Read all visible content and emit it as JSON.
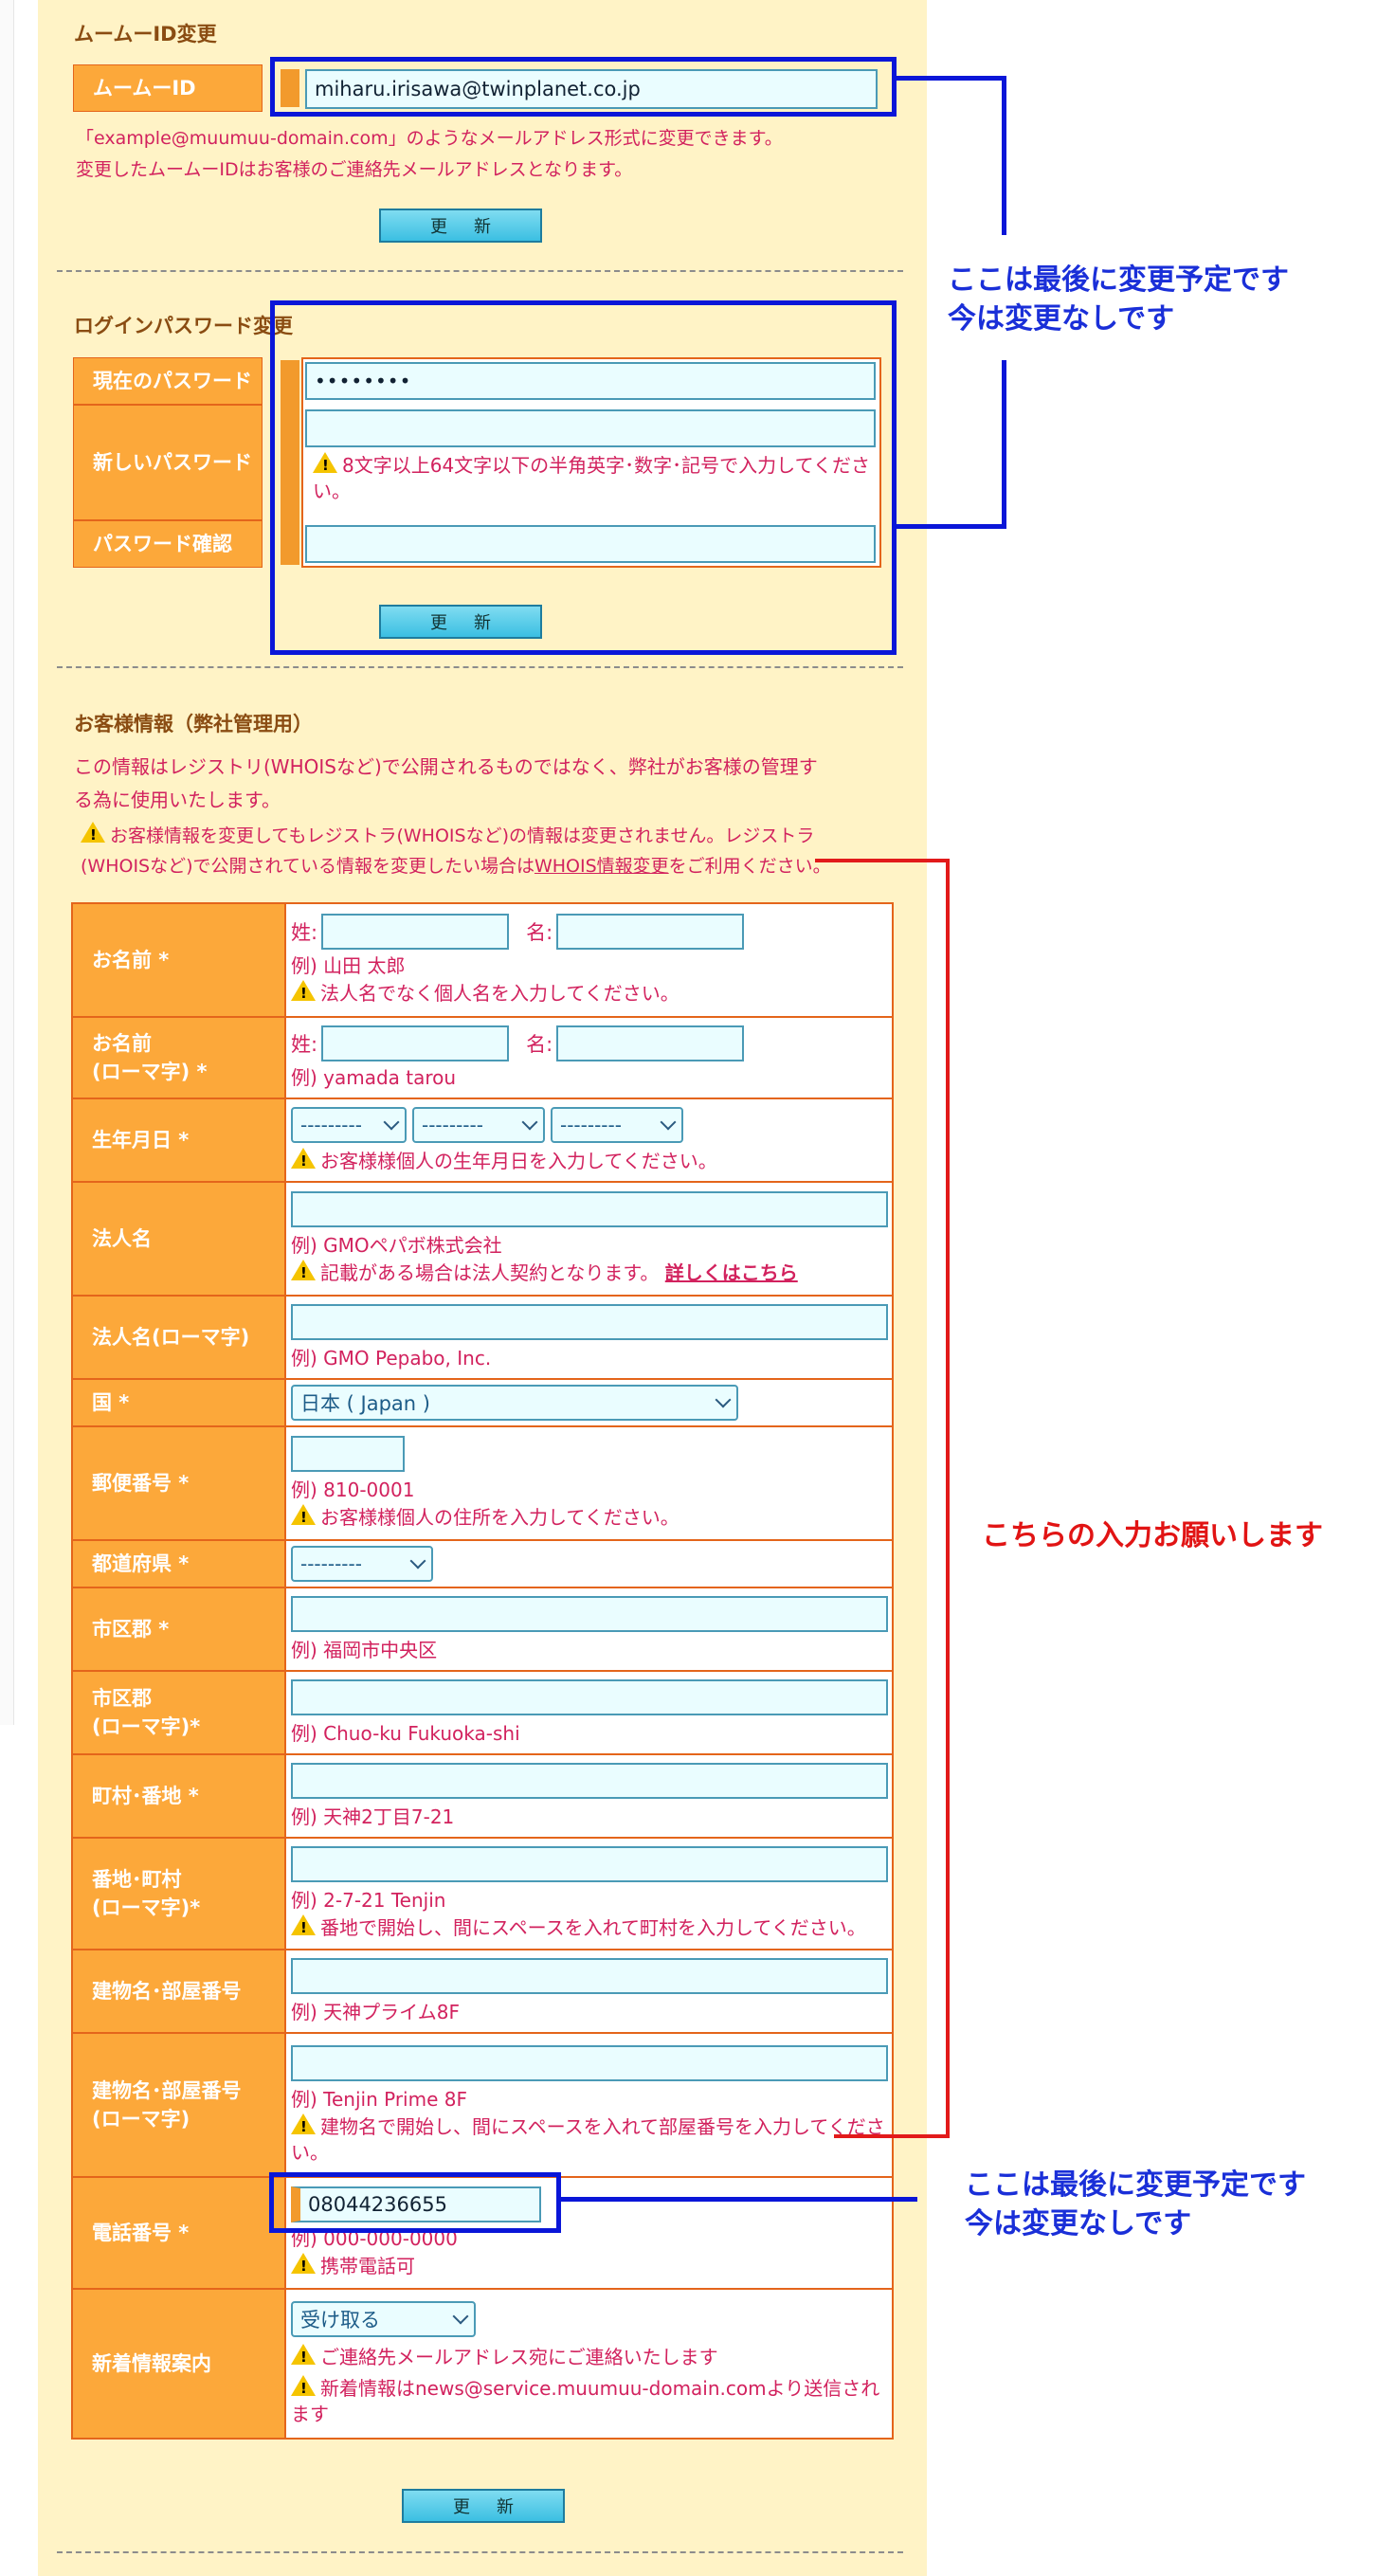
{
  "id_section": {
    "title": "ムームーID変更",
    "label": "ムームーID",
    "value": "miharu.irisawa@twinplanet.co.jp",
    "note1": "「example@muumuu-domain.com」のようなメールアドレス形式に変更できます。",
    "note2": "変更したムームーIDはお客様のご連絡先メールアドレスとなります。",
    "button": "更新"
  },
  "password_section": {
    "title": "ログインパスワード変更",
    "current_label": "現在のパスワード",
    "current_value": "••••••••",
    "new_label": "新しいパスワード",
    "new_hint": "8文字以上64文字以下の半角英字･数字･記号で入力してください。",
    "confirm_label": "パスワード確認",
    "button": "更新"
  },
  "customer_section": {
    "title": "お客様情報（弊社管理用）",
    "desc1": "この情報はレジストリ(WHOISなど)で公開されるものではなく、弊社がお客様の管理す",
    "desc2": "る為に使用いたします。",
    "warn1": "お客様情報を変更してもレジストラ(WHOISなど)の情報は変更されません。レジストラ",
    "warn2_pre": "(WHOISなど)で公開されている情報を変更したい場合は",
    "warn2_link": "WHOIS情報変更",
    "warn2_post": "をご利用ください。"
  },
  "fields": {
    "name": {
      "label": "お名前 *",
      "sei": "姓:",
      "mei": "名:",
      "example": "例) 山田 太郎",
      "warn": "法人名でなく個人名を入力してください。"
    },
    "name_roman": {
      "label1": "お名前",
      "label2": "(ローマ字) *",
      "sei": "姓:",
      "mei": "名:",
      "example": "例) yamada tarou"
    },
    "birth": {
      "label": "生年月日 *",
      "placeholder": "---------",
      "warn": "お客様様個人の生年月日を入力してください。"
    },
    "corp": {
      "label": "法人名",
      "example": "例) GMOペパボ株式会社",
      "warn": "記載がある場合は法人契約となります。",
      "link": "詳しくはこちら"
    },
    "corp_roman": {
      "label": "法人名(ローマ字)",
      "example": "例) GMO Pepabo, Inc."
    },
    "country": {
      "label": "国 *",
      "value": "日本 ( Japan )"
    },
    "zip": {
      "label": "郵便番号 *",
      "example": "例) 810-0001",
      "warn": "お客様様個人の住所を入力してください。"
    },
    "pref": {
      "label": "都道府県 *",
      "value": "---------"
    },
    "city": {
      "label": "市区郡 *",
      "example": "例) 福岡市中央区"
    },
    "city_roman": {
      "label1": "市区郡",
      "label2": "(ローマ字)*",
      "example": "例) Chuo-ku Fukuoka-shi"
    },
    "street": {
      "label": "町村･番地 *",
      "example": "例) 天神2丁目7-21"
    },
    "street_roman": {
      "label1": "番地･町村",
      "label2": "(ローマ字)*",
      "example": "例) 2-7-21 Tenjin",
      "warn": "番地で開始し、間にスペースを入れて町村を入力してください。"
    },
    "building": {
      "label": "建物名･部屋番号",
      "example": "例) 天神プライム8F"
    },
    "building_roman": {
      "label1": "建物名･部屋番号",
      "label2": "(ローマ字)",
      "example": "例) Tenjin Prime 8F",
      "warn": "建物名で開始し、間にスペースを入れて部屋番号を入力してください。"
    },
    "phone": {
      "label": "電話番号 *",
      "value": "08044236655",
      "example": "例) 000-000-0000",
      "warn": "携帯電話可"
    },
    "news": {
      "label": "新着情報案内",
      "value": "受け取る",
      "warn1": "ご連絡先メールアドレス宛にご連絡いたします",
      "warn2": "新着情報はnews@service.muumuu-domain.comより送信されます"
    }
  },
  "bottom_button": "更新",
  "annotations": {
    "top_blue_line1": "ここは最後に変更予定です",
    "top_blue_line2": "今は変更なしです",
    "red": "こちらの入力お願いします",
    "bottom_blue_line1": "ここは最後に変更予定です",
    "bottom_blue_line2": "今は変更なしです",
    "blue_color": "#0a16d8",
    "red_color": "#e21a1a"
  }
}
